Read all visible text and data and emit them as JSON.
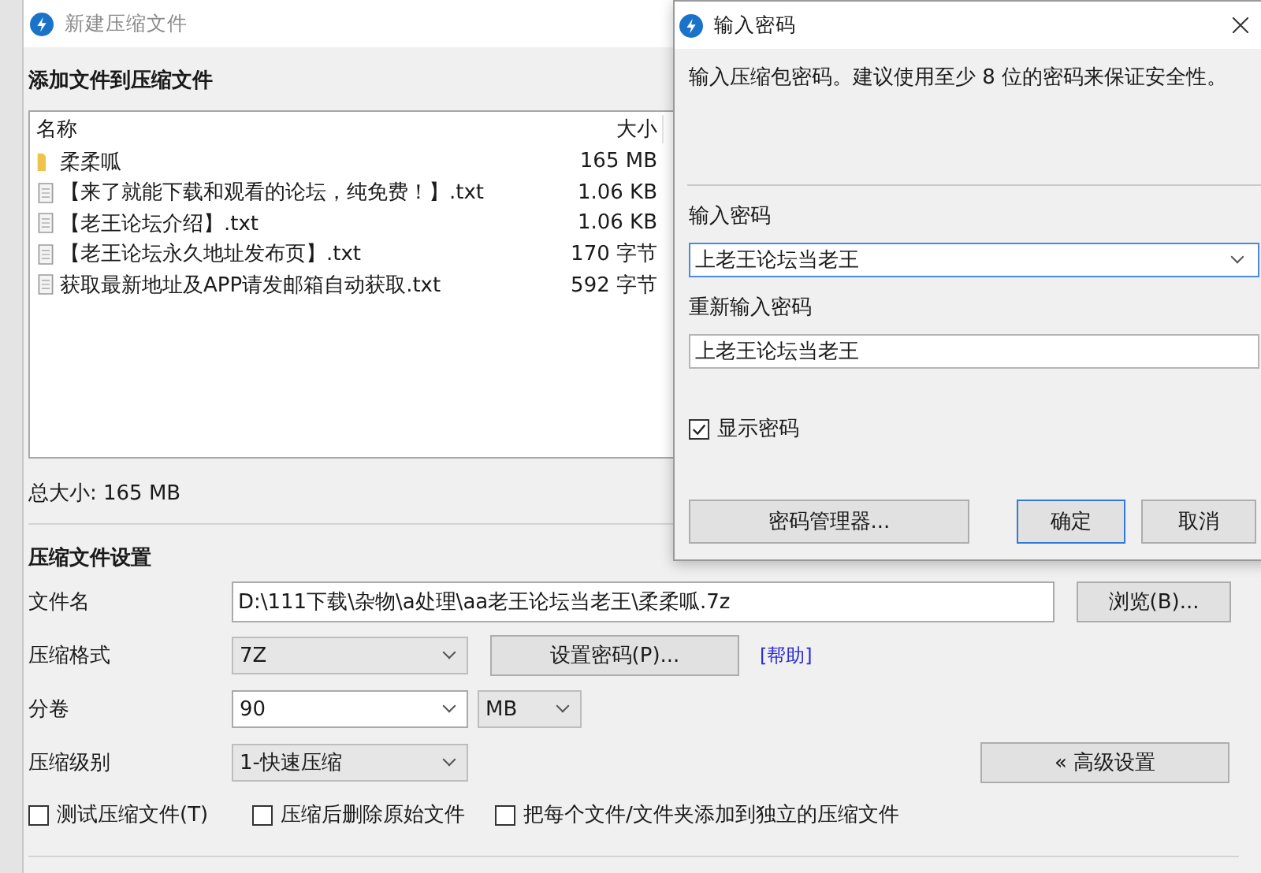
{
  "main_window": {
    "title": "新建压缩文件",
    "section_title": "添加文件到压缩文件",
    "file_list": {
      "columns": [
        "名称",
        "大小"
      ],
      "rows": [
        {
          "kind": "folder",
          "name": "柔柔呱",
          "size": "165 MB"
        },
        {
          "kind": "file",
          "name": "【来了就能下载和观看的论坛，纯免费！】.txt",
          "size": "1.06 KB"
        },
        {
          "kind": "file",
          "name": "【老王论坛介绍】.txt",
          "size": "1.06 KB"
        },
        {
          "kind": "file",
          "name": "【老王论坛永久地址发布页】.txt",
          "size": "170 字节"
        },
        {
          "kind": "file",
          "name": "获取最新地址及APP请发邮箱自动获取.txt",
          "size": "592 字节"
        }
      ]
    },
    "total_size": "总大小: 165 MB",
    "settings": {
      "title": "压缩文件设置",
      "filename": {
        "label": "文件名",
        "value": "D:\\111下载\\杂物\\a处理\\aa老王论坛当老王\\柔柔呱.7z"
      },
      "browse_button": "浏览(B)...",
      "format": {
        "label": "压缩格式",
        "value": "7Z"
      },
      "set_password_button": "设置密码(P)...",
      "help_link": "[帮助]",
      "volume": {
        "label": "分卷",
        "value": "90",
        "unit": "MB"
      },
      "level": {
        "label": "压缩级别",
        "value": "1-快速压缩"
      },
      "advanced_button": "« 高级设置",
      "options": [
        {
          "label": "测试压缩文件(T)",
          "checked": false
        },
        {
          "label": "压缩后删除原始文件",
          "checked": false
        },
        {
          "label": "把每个文件/文件夹添加到独立的压缩文件",
          "checked": false
        }
      ]
    }
  },
  "password_dialog": {
    "title": "输入密码",
    "message": "输入压缩包密码。建议使用至少 8 位的密码来保证安全性。",
    "password": {
      "label": "输入密码",
      "value": "上老王论坛当老王"
    },
    "confirm": {
      "label": "重新输入密码",
      "value": "上老王论坛当老王"
    },
    "show_password": {
      "label": "显示密码",
      "checked": true
    },
    "buttons": [
      {
        "label": "密码管理器...",
        "kind": "wide"
      },
      {
        "label": "确定",
        "kind": "default"
      },
      {
        "label": "取消",
        "kind": "normal"
      }
    ]
  }
}
